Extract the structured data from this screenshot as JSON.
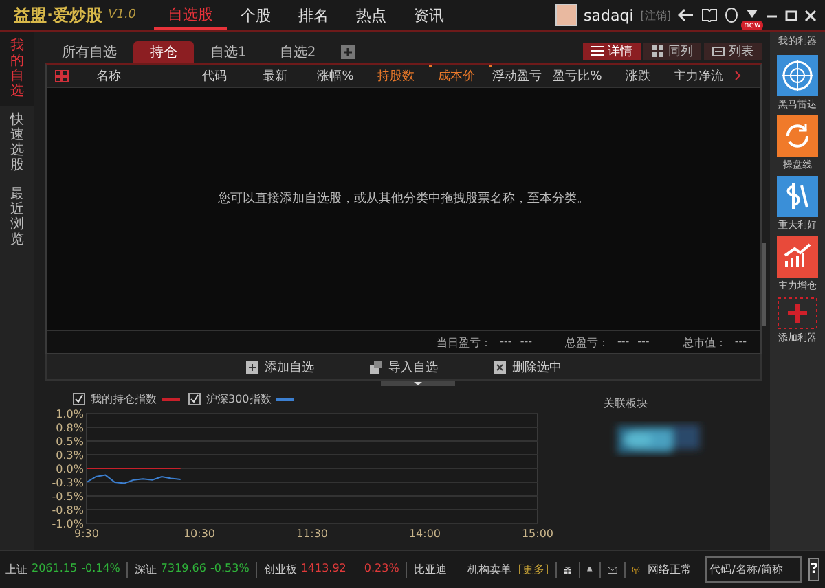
{
  "app": {
    "title": "益盟·爱炒股",
    "version": "V1.0"
  },
  "nav_tabs": [
    {
      "label": "自选股",
      "selected": true
    },
    {
      "label": "个股",
      "selected": false
    },
    {
      "label": "排名",
      "selected": false
    },
    {
      "label": "热点",
      "selected": false
    },
    {
      "label": "资讯",
      "selected": false
    }
  ],
  "user": {
    "name": "sadaqi",
    "logout": "[注销]",
    "badge": "new"
  },
  "left_nav": [
    {
      "label": "我的自选",
      "selected": true
    },
    {
      "label": "快速选股",
      "selected": false
    },
    {
      "label": "最近浏览",
      "selected": false
    }
  ],
  "tabs": [
    {
      "label": "所有自选",
      "selected": false
    },
    {
      "label": "持仓",
      "selected": true
    },
    {
      "label": "自选1",
      "selected": false
    },
    {
      "label": "自选2",
      "selected": false
    }
  ],
  "view_buttons": [
    {
      "label": "详情",
      "selected": true,
      "kind": "lines"
    },
    {
      "label": "同列",
      "selected": false,
      "kind": "grid"
    },
    {
      "label": "列表",
      "selected": false,
      "kind": "table"
    }
  ],
  "table": {
    "columns": [
      {
        "label": "名称",
        "highlighted": false
      },
      {
        "label": "代码",
        "highlighted": false
      },
      {
        "label": "最新",
        "highlighted": false
      },
      {
        "label": "涨幅%",
        "highlighted": false
      },
      {
        "label": "持股数",
        "highlighted": true
      },
      {
        "label": "成本价",
        "highlighted": true
      },
      {
        "label": "浮动盈亏",
        "highlighted": false
      },
      {
        "label": "盈亏比%",
        "highlighted": false
      },
      {
        "label": "涨跌",
        "highlighted": false
      },
      {
        "label": "主力净流",
        "highlighted": false
      }
    ],
    "empty_message": "您可以直接添加自选股，或从其他分类中拖拽股票名称，至本分类。"
  },
  "summary": [
    {
      "label": "当日盈亏：",
      "values": [
        "---",
        "---"
      ]
    },
    {
      "label": "总盈亏：",
      "values": [
        "---",
        "---"
      ]
    },
    {
      "label": "总市值：",
      "values": [
        "---"
      ]
    }
  ],
  "actions": [
    {
      "label": "添加自选",
      "kind": "add"
    },
    {
      "label": "导入自选",
      "kind": "import"
    },
    {
      "label": "删除选中",
      "kind": "delete"
    }
  ],
  "chart": {
    "legend": [
      {
        "checked": true
      },
      {
        "checked": true
      }
    ],
    "chart_data": {
      "type": "line",
      "categories": [
        "9:30",
        null,
        null,
        null,
        null,
        null,
        null,
        null,
        null,
        null,
        null,
        null,
        "10:30",
        null,
        null,
        null,
        null,
        null,
        null,
        null,
        null,
        null,
        null,
        null,
        "11:30",
        null,
        null,
        null,
        null,
        null,
        null,
        null,
        null,
        null,
        null,
        null,
        "14:00",
        null,
        null,
        null,
        null,
        null,
        null,
        null,
        null,
        null,
        null,
        null,
        "15:00"
      ],
      "series": [
        {
          "name": "我的持仓指数",
          "color": "#c8202a",
          "values": [
            0,
            0,
            0,
            0,
            0,
            0,
            0,
            0,
            0,
            0,
            0,
            null,
            null,
            null,
            null,
            null,
            null,
            null,
            null,
            null,
            null,
            null,
            null,
            null,
            null,
            null,
            null,
            null,
            null,
            null,
            null,
            null,
            null,
            null,
            null,
            null,
            null,
            null,
            null,
            null,
            null,
            null,
            null,
            null,
            null,
            null,
            null,
            null,
            null
          ]
        },
        {
          "name": "沪深300指数",
          "color": "#3c7fd0",
          "values": [
            -0.25,
            -0.15,
            -0.12,
            -0.25,
            -0.27,
            -0.21,
            -0.19,
            -0.21,
            -0.15,
            -0.18,
            -0.2,
            null,
            null,
            null,
            null,
            null,
            null,
            null,
            null,
            null,
            null,
            null,
            null,
            null,
            null,
            null,
            null,
            null,
            null,
            null,
            null,
            null,
            null,
            null,
            null,
            null,
            null,
            null,
            null,
            null,
            null,
            null,
            null,
            null,
            null,
            null,
            null,
            null,
            null
          ]
        }
      ],
      "ylim": [
        -1,
        1
      ],
      "grid": true,
      "yticks": [
        {
          "value": 1,
          "label": "1.0%"
        },
        {
          "value": 0.75,
          "label": "0.8%"
        },
        {
          "value": 0.5,
          "label": "0.5%"
        },
        {
          "value": 0.25,
          "label": "0.3%"
        },
        {
          "value": 0,
          "label": "0.0%"
        },
        {
          "value": -0.25,
          "label": "-0.3%"
        },
        {
          "value": -0.5,
          "label": "-0.5%"
        },
        {
          "value": -0.75,
          "label": "-0.8%"
        },
        {
          "value": -1,
          "label": "-1.0%"
        }
      ]
    }
  },
  "related": {
    "title": "关联板块"
  },
  "tools": {
    "title": "我的利器",
    "items": [
      {
        "label": "黑马雷达",
        "kind": "radar",
        "color": "#3a8fd8"
      },
      {
        "label": "操盘线",
        "kind": "cycle",
        "color": "#f07a2a"
      },
      {
        "label": "重大利好",
        "kind": "dollar",
        "color": "#3a8fd8"
      },
      {
        "label": "主力增仓",
        "kind": "bars",
        "color": "#e84a3a"
      },
      {
        "label": "添加利器",
        "kind": "add",
        "color": "#d0202a"
      }
    ]
  },
  "status_bar": {
    "indices": [
      {
        "name": "上证",
        "value": "2061.15",
        "change": "-0.14%",
        "color": "#2fb33a"
      },
      {
        "name": "深证",
        "value": "7319.66",
        "change": "-0.53%",
        "color": "#2fb33a"
      },
      {
        "name": "创业板",
        "value": "1413.92",
        "change": "0.23%",
        "color": "#e03a3a"
      }
    ],
    "stock": "比亚迪",
    "orders": "机构卖单",
    "more": "[更多]",
    "network": "网络正常",
    "search": {
      "placeholder": "代码/名称/简称"
    },
    "help": "?"
  }
}
